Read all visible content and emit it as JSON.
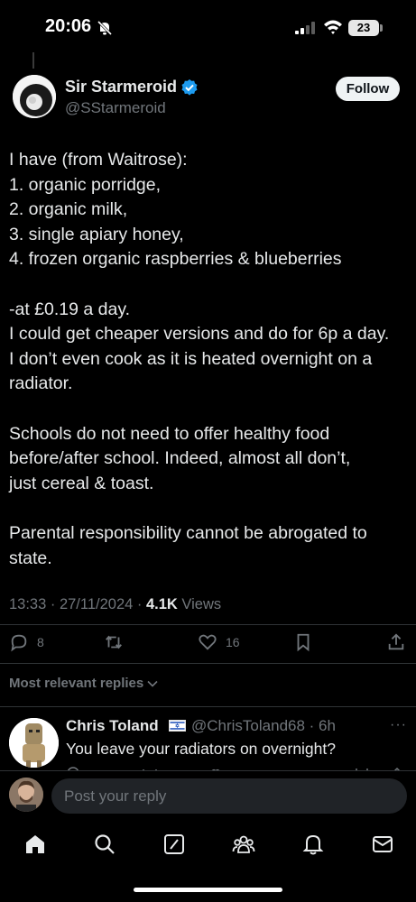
{
  "status_bar": {
    "time": "20:06",
    "battery": "23",
    "icons": [
      "bell-off-icon",
      "signal-icon",
      "wifi-icon",
      "battery-icon"
    ]
  },
  "author": {
    "name": "Sir Starmeroid",
    "handle": "@SStarmeroid",
    "verified": true,
    "follow_label": "Follow"
  },
  "tweet": {
    "lines": [
      "I have (from Waitrose):",
      "1. organic porridge,",
      "2. organic milk,",
      "3. single apiary honey,",
      "4. frozen organic raspberries & blueberries",
      "",
      "-at £0.19 a day.",
      "I could get cheaper versions and do for 6p a day.",
      "I don’t even cook as it is heated overnight on a",
      "radiator.",
      "",
      "Schools do not need to offer healthy food",
      "before/after school. Indeed, almost all don’t,",
      "just cereal & toast.",
      "",
      "Parental responsibility cannot be abrogated to",
      "state."
    ]
  },
  "meta": {
    "time": "13:33 · 27/11/2024 · ",
    "views_count": "4.1K",
    "views_label": " Views"
  },
  "actions": {
    "replies": "8",
    "reposts": "",
    "likes": "16"
  },
  "replies_filter": {
    "label": "Most relevant replies"
  },
  "reply": {
    "name": "Chris Toland",
    "handle": "@ChrisToland68 · 6h",
    "text": "You leave your radiators on overnight?",
    "more": "···"
  },
  "composer": {
    "placeholder": "Post your reply"
  },
  "nav": {
    "items": [
      "home-icon",
      "search-icon",
      "grok-icon",
      "communities-icon",
      "notifications-icon",
      "messages-icon"
    ]
  },
  "colors": {
    "background": "#000000",
    "text": "#e7e9ea",
    "muted": "#71767b",
    "verified_blue": "#1d9bf0",
    "divider": "#2f3336"
  }
}
